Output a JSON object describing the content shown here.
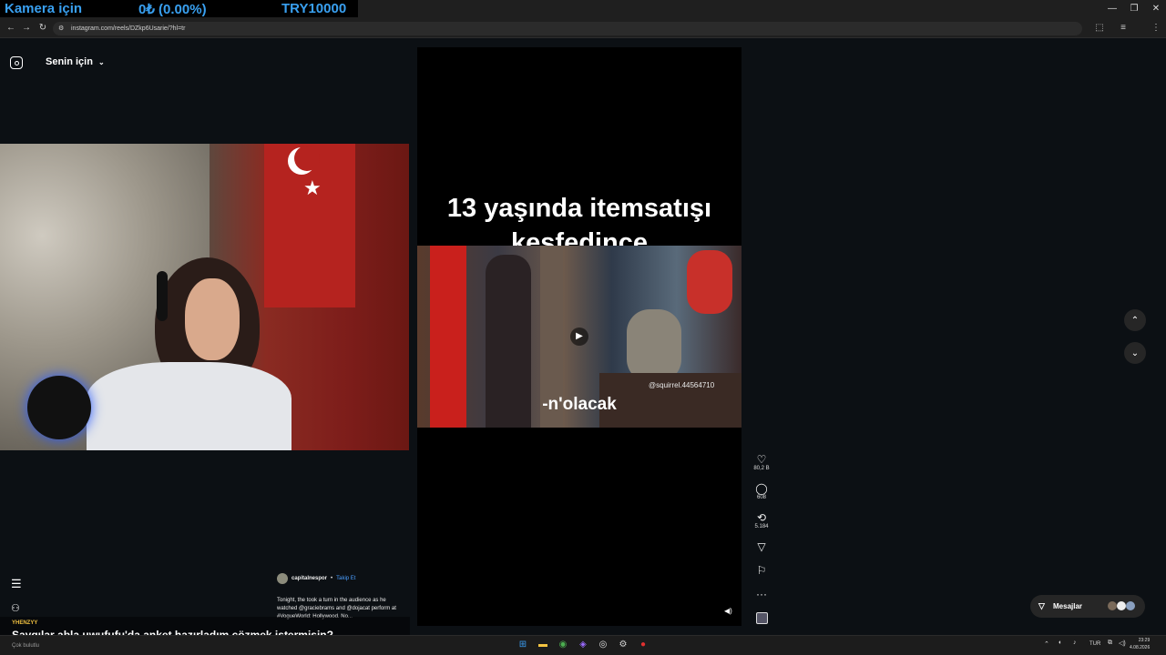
{
  "overlay": {
    "label": "Kamera için",
    "balance": "0₺ (0.00%)",
    "currency": "TRY10000"
  },
  "browser": {
    "url": "instagram.com/reels/DZkp6Usarie/?hl=tr"
  },
  "sidebar": {
    "feed_title": "Senin için"
  },
  "reel": {
    "caption": "13 yaşında itemsatışı keşfedince",
    "subtitle": "-n'olacak",
    "watermark": "@squirrel.44564710",
    "likes": "80,2 B",
    "comments": "608",
    "reposts": "5.184"
  },
  "post": {
    "username": "capitalnespor",
    "follow": "Takip Et",
    "description": "Tonight, the took a turn in the audience as he watched @graciebrams and @dojacat perform at #VogueWorld: Hollywood. No..."
  },
  "messages": {
    "label": "Mesajlar"
  },
  "chat": {
    "user": "YHENZYY",
    "message": "Saygılar abla uwufufu'da anket hazırladım çözmek istermisin?",
    "sub": "Çok bulutlu"
  },
  "taskbar": {
    "lang": "TUR",
    "time": "23:29",
    "date": "4.08.2026"
  },
  "colors": {
    "instagram_bg": "#0c1014",
    "overlay_text": "#39a0f0",
    "follow_link": "#4a9eff"
  }
}
